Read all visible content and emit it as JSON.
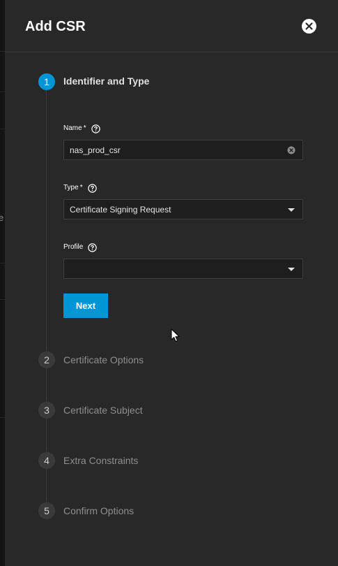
{
  "dialog": {
    "title": "Add CSR"
  },
  "steps": [
    {
      "number": "1",
      "label": "Identifier and Type",
      "active": true
    },
    {
      "number": "2",
      "label": "Certificate Options",
      "active": false
    },
    {
      "number": "3",
      "label": "Certificate Subject",
      "active": false
    },
    {
      "number": "4",
      "label": "Extra Constraints",
      "active": false
    },
    {
      "number": "5",
      "label": "Confirm Options",
      "active": false
    }
  ],
  "form": {
    "name": {
      "label": "Name",
      "required_mark": "*",
      "value": "nas_prod_csr"
    },
    "type": {
      "label": "Type",
      "required_mark": "*",
      "value": "Certificate Signing Request"
    },
    "profile": {
      "label": "Profile",
      "value": ""
    }
  },
  "actions": {
    "next_label": "Next"
  },
  "backdrop": {
    "partial_text": "e"
  },
  "colors": {
    "accent": "#0095d5",
    "panel": "#282828",
    "input_bg": "#1e1e1e"
  }
}
